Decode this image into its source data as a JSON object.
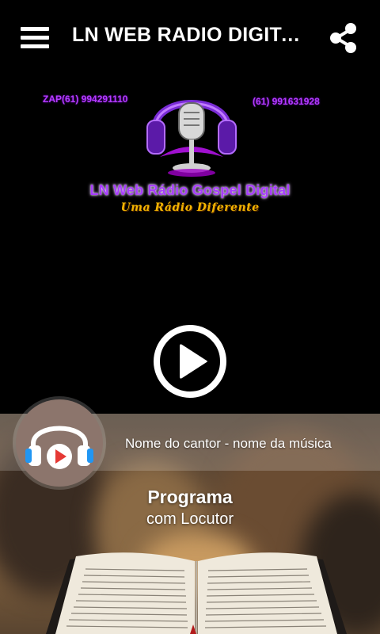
{
  "app": {
    "title": "LN WEB RADIO DIGITAL GOSPEL",
    "menu_icon": "hamburger-menu-icon",
    "share_icon": "share-icon"
  },
  "logo": {
    "zap": "ZAP(61) 994291110",
    "phone": "(61) 991631928",
    "name": "LN Web Rádio Gospel Digital",
    "slogan": "Uma Rádio Diferente",
    "colors": {
      "purple": "#a83cff",
      "gold": "#f2b400"
    }
  },
  "player": {
    "play_icon": "play-icon",
    "now_playing": "Nome do cantor - nome da música",
    "avatar_icon": "headphones-play-icon",
    "program_title": "Programa",
    "program_host": "com Locutor"
  }
}
